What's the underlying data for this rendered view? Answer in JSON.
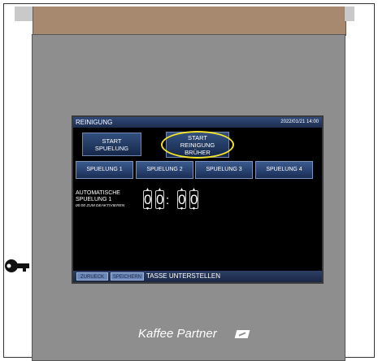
{
  "screen": {
    "title": "REINIGUNG",
    "datetime": "2022/01/21  14:00",
    "start_spuelung": [
      "START",
      "SPUELUNG"
    ],
    "start_reinigung": [
      "START",
      "REINIGUNG",
      "BRÜHER"
    ],
    "spuelung_buttons": [
      "SPUELUNG 1",
      "SPUELUNG 2",
      "SPUELUNG 3",
      "SPUELUNG 4"
    ],
    "auto_label_line1": "AUTOMATISCHE",
    "auto_label_line2": "SPUELUNG 1",
    "auto_hint": "00:00 ZUM DEAKTIVIEREN",
    "time_digits": [
      "0",
      "0",
      "0",
      "0"
    ],
    "time_separator": ":",
    "back_label": "ZURUECK",
    "save_label": "SPEICHERN",
    "status_text": "TASSE UNTERSTELLEN"
  },
  "brand": {
    "name": "Kaffee Partner",
    "icon": "kaffee-partner-logo-icon"
  },
  "colors": {
    "highlight": "#f2e02c",
    "button_blue": "#32507e",
    "panel_gray": "#8e8e8e",
    "top_brown": "#a6896e"
  }
}
